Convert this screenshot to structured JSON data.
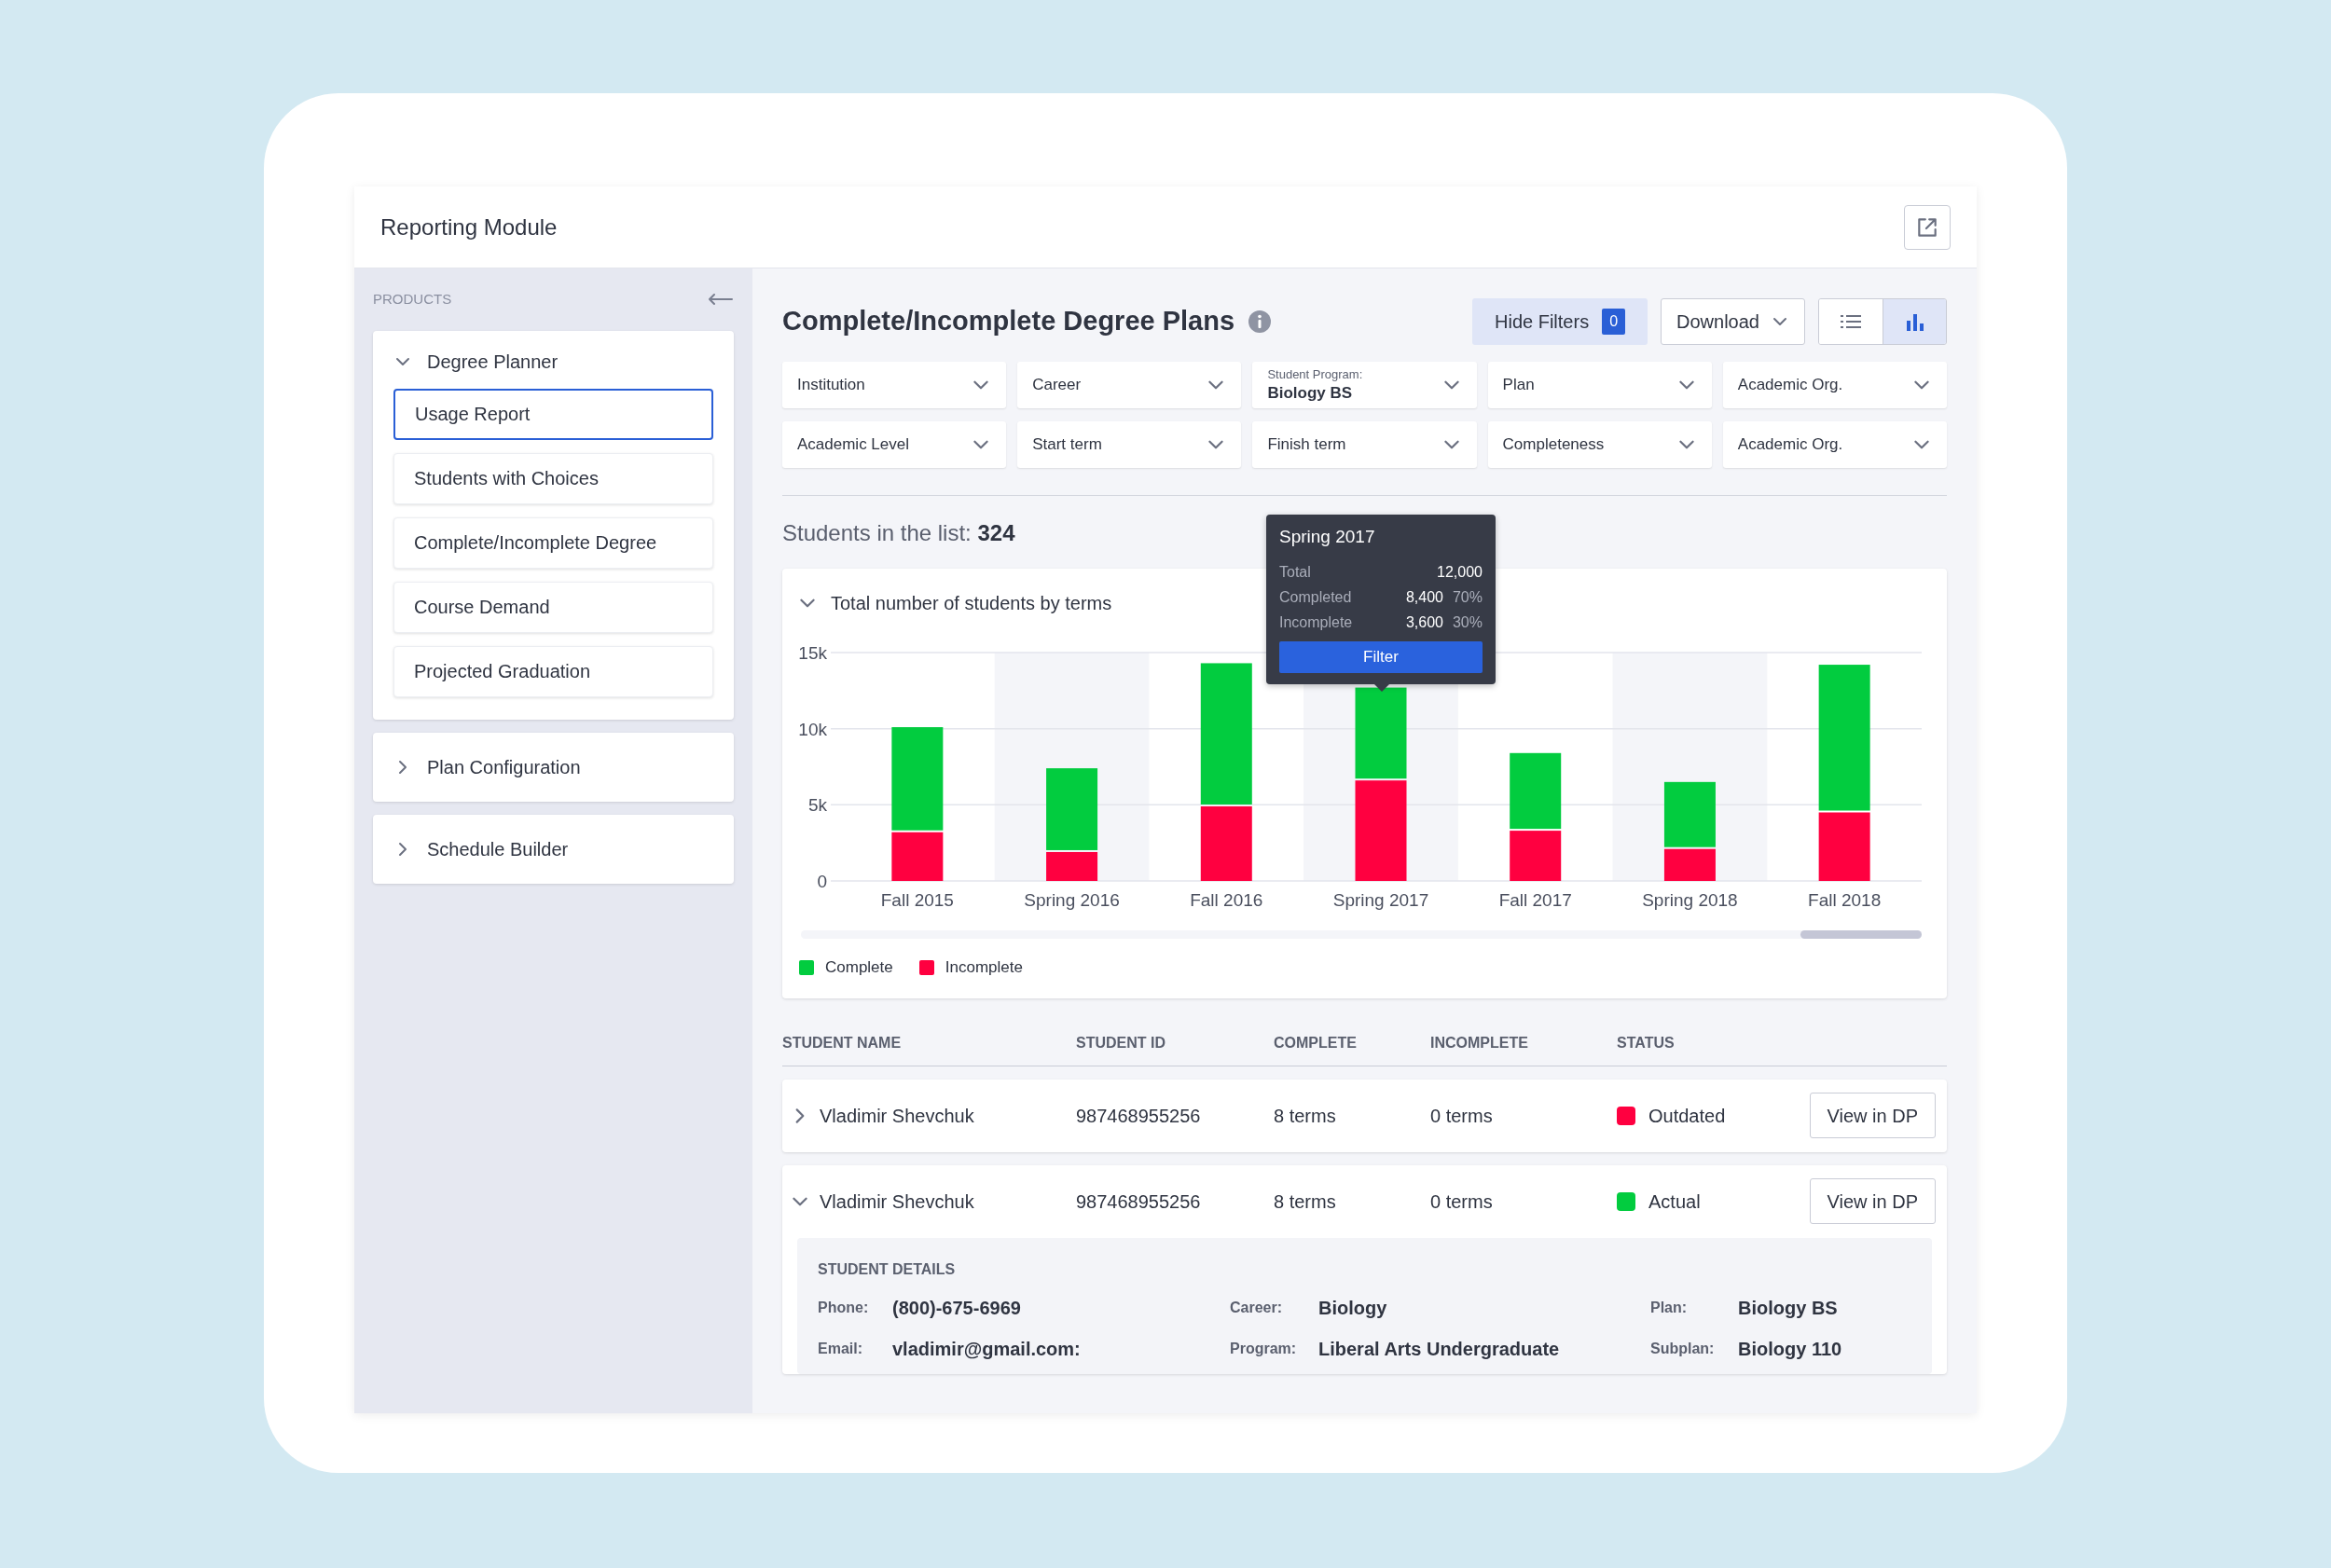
{
  "window": {
    "title": "Reporting Module"
  },
  "sidebar": {
    "heading": "PRODUCTS",
    "groups": [
      {
        "label": "Degree Planner",
        "expanded": true,
        "items": [
          {
            "label": "Usage Report",
            "selected": true
          },
          {
            "label": "Students with Choices",
            "selected": false
          },
          {
            "label": "Complete/Incomplete Degree",
            "selected": false
          },
          {
            "label": "Course Demand",
            "selected": false
          },
          {
            "label": "Projected Graduation",
            "selected": false
          }
        ]
      },
      {
        "label": "Plan Configuration",
        "expanded": false
      },
      {
        "label": "Schedule Builder",
        "expanded": false
      }
    ]
  },
  "main": {
    "title": "Complete/Incomplete Degree Plans",
    "hide_filters": {
      "label": "Hide Filters",
      "count": "0"
    },
    "download": {
      "label": "Download"
    },
    "views": [
      {
        "kind": "list",
        "selected": false
      },
      {
        "kind": "chart",
        "selected": true
      }
    ],
    "filters": [
      {
        "label": "Institution"
      },
      {
        "label": "Career"
      },
      {
        "caption": "Student Program:",
        "value": "Biology BS"
      },
      {
        "label": "Plan"
      },
      {
        "label": "Academic Org."
      },
      {
        "label": "Academic Level"
      },
      {
        "label": "Start term"
      },
      {
        "label": "Finish term"
      },
      {
        "label": "Completeness"
      },
      {
        "label": "Academic Org."
      }
    ],
    "count": {
      "label": "Students in the list:",
      "value": "324"
    },
    "chart_card": {
      "title": "Total number of students by terms",
      "expanded": true,
      "chart_data": {
        "type": "bar",
        "stacked": true,
        "categories": [
          "Fall 2015",
          "Spring 2016",
          "Fall 2016",
          "Spring 2017",
          "Fall 2017",
          "Spring 2018",
          "Fall 2018"
        ],
        "series": [
          {
            "name": "Incomplete",
            "color": "#ff0040",
            "values": [
              3200,
              1900,
              4900,
              6600,
              3300,
              2100,
              4500
            ]
          },
          {
            "name": "Complete",
            "color": "#02cc3f",
            "values": [
              6900,
              5500,
              9400,
              6100,
              5100,
              4400,
              9700
            ]
          }
        ],
        "ylim": [
          0,
          15000
        ],
        "yticks": [
          {
            "value": 0,
            "label": "0"
          },
          {
            "value": 5000,
            "label": "5k"
          },
          {
            "value": 10000,
            "label": "10k"
          },
          {
            "value": 15000,
            "label": "15k"
          }
        ]
      },
      "tooltip": {
        "title": "Spring 2017",
        "rows": [
          {
            "label": "Total",
            "value": "12,000"
          },
          {
            "label": "Completed",
            "value": "8,400",
            "percent": "70%"
          },
          {
            "label": "Incomplete",
            "value": "3,600",
            "percent": "30%"
          }
        ],
        "button": "Filter"
      }
    },
    "table": {
      "columns": [
        "STUDENT NAME",
        "STUDENT ID",
        "COMPLETE",
        "INCOMPLETE",
        "STATUS"
      ],
      "rows": [
        {
          "name": "Vladimir Shevchuk",
          "id": "987468955256",
          "complete": "8 terms",
          "incomplete": "0 terms",
          "status": "Outdated",
          "color": "#ff0040",
          "button": "View in DP",
          "expanded": false
        },
        {
          "name": "Vladimir Shevchuk",
          "id": "987468955256",
          "complete": "8 terms",
          "incomplete": "0 terms",
          "status": "Actual",
          "color": "#02cc3f",
          "button": "View in DP",
          "expanded": true,
          "details": {
            "heading": "STUDENT DETAILS",
            "fields": [
              {
                "label": "Phone:",
                "value": "(800)-675-6969"
              },
              {
                "label": "Career:",
                "value": "Biology"
              },
              {
                "label": "Plan:",
                "value": "Biology BS"
              },
              {
                "label": "Email:",
                "value": "vladimir@gmail.com:"
              },
              {
                "label": "Program:",
                "value": "Liberal Arts Undergraduate"
              },
              {
                "label": "Subplan:",
                "value": "Biology 110"
              }
            ]
          }
        }
      ]
    }
  }
}
